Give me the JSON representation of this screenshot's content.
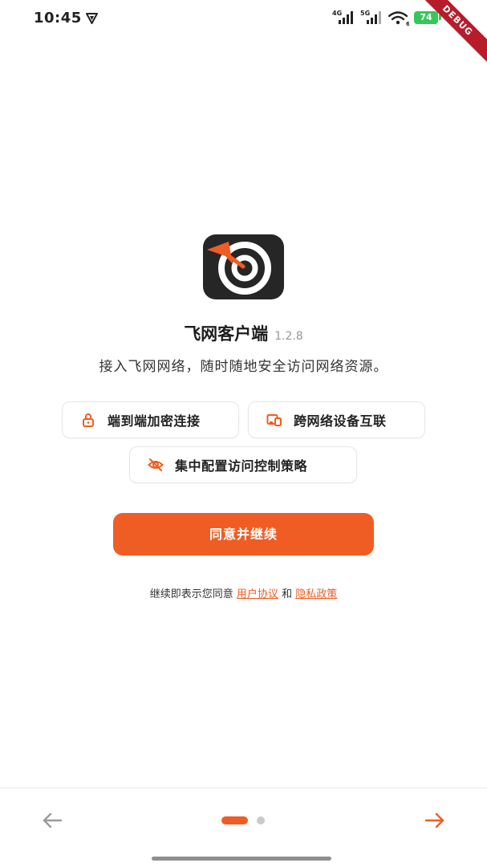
{
  "status_bar": {
    "time": "10:45",
    "signal_1_label": "4G",
    "signal_2_label": "5G",
    "wifi_label": "6",
    "battery": "74",
    "debug_banner": "DEBUG"
  },
  "app": {
    "name": "飞网客户端",
    "version": "1.2.8",
    "subtitle": "接入飞网网络，随时随地安全访问网络资源。"
  },
  "features": [
    {
      "label": "端到端加密连接",
      "icon": "lock-icon"
    },
    {
      "label": "跨网络设备互联",
      "icon": "devices-icon"
    },
    {
      "label": "集中配置访问控制策略",
      "icon": "eye-off-icon"
    }
  ],
  "primary_button": "同意并继续",
  "terms": {
    "prefix": "继续即表示您同意",
    "user_agreement": "用户协议",
    "and": "和",
    "privacy_policy": "隐私政策"
  },
  "colors": {
    "accent": "#ef5d24",
    "icon_bg": "#262626",
    "battery": "#35c759",
    "debug": "#b71c2b"
  },
  "pager": {
    "current_page": 1,
    "total_pages": 2
  }
}
